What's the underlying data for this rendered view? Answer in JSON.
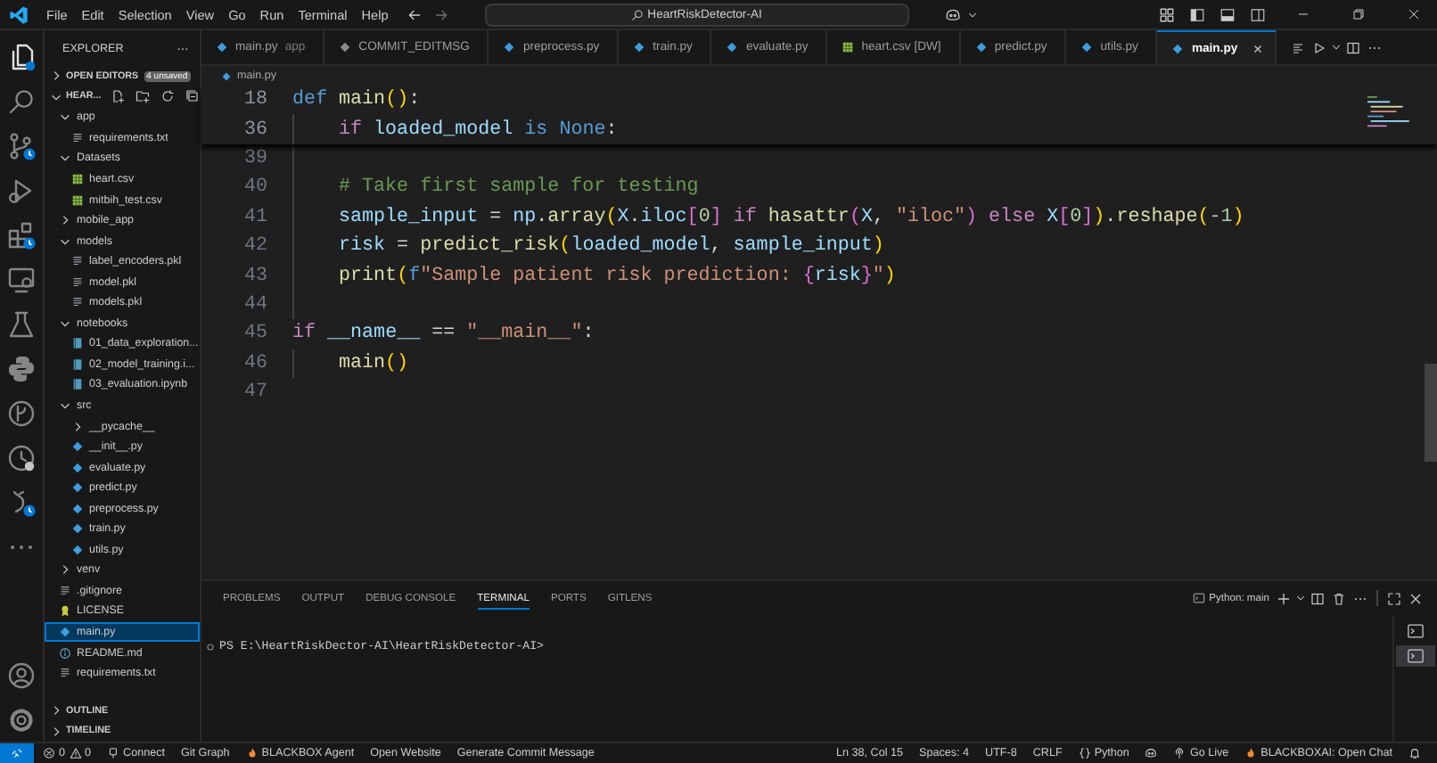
{
  "title_bar": {
    "menu": [
      "File",
      "Edit",
      "Selection",
      "View",
      "Go",
      "Run",
      "Terminal",
      "Help"
    ],
    "search": {
      "value": "HeartRiskDetector-AI"
    }
  },
  "activity_bar": [
    {
      "kind": "explorer",
      "selected": true
    },
    {
      "kind": "search",
      "selected": false
    },
    {
      "kind": "source-control",
      "selected": false
    },
    {
      "kind": "run",
      "selected": false
    },
    {
      "kind": "extensions",
      "selected": false
    },
    {
      "kind": "remote",
      "selected": false
    },
    {
      "kind": "testing",
      "selected": false
    },
    {
      "kind": "python",
      "selected": false
    },
    {
      "kind": "git-graph",
      "selected": false
    },
    {
      "kind": "history",
      "selected": false
    },
    {
      "kind": "agent",
      "selected": false
    },
    {
      "kind": "more",
      "selected": false
    }
  ],
  "explorer": {
    "title": "EXPLORER",
    "open_editors": {
      "label": "OPEN EDITORS",
      "badge": "4 unsaved",
      "expanded": false
    },
    "folder": {
      "label": "HEAR...",
      "expanded": true
    },
    "tree": [
      {
        "label": "app",
        "kind": "folder",
        "expanded": true,
        "selected": false,
        "children": [
          {
            "label": "requirements.txt",
            "kind": "text",
            "selected": false
          }
        ]
      },
      {
        "label": "Datasets",
        "kind": "folder",
        "expanded": true,
        "selected": false,
        "children": [
          {
            "label": "heart.csv",
            "kind": "table",
            "selected": false
          },
          {
            "label": "mitbih_test.csv",
            "kind": "table",
            "selected": false
          }
        ]
      },
      {
        "label": "mobile_app",
        "kind": "folder",
        "expanded": false,
        "selected": false
      },
      {
        "label": "models",
        "kind": "folder",
        "expanded": true,
        "selected": false,
        "children": [
          {
            "label": "label_encoders.pkl",
            "kind": "text",
            "selected": false
          },
          {
            "label": "model.pkl",
            "kind": "text",
            "selected": false
          },
          {
            "label": "models.pkl",
            "kind": "text",
            "selected": false
          }
        ]
      },
      {
        "label": "notebooks",
        "kind": "folder",
        "expanded": true,
        "selected": false,
        "children": [
          {
            "label": "01_data_exploration...",
            "kind": "notebook",
            "selected": false
          },
          {
            "label": "02_model_training.i...",
            "kind": "notebook",
            "selected": false
          },
          {
            "label": "03_evaluation.ipynb",
            "kind": "notebook",
            "selected": false
          }
        ]
      },
      {
        "label": "src",
        "kind": "folder",
        "expanded": true,
        "selected": false,
        "children": [
          {
            "label": "__pycache__",
            "kind": "folder",
            "expanded": false,
            "selected": false
          },
          {
            "label": "__init__.py",
            "kind": "python",
            "selected": false
          },
          {
            "label": "evaluate.py",
            "kind": "python",
            "selected": false
          },
          {
            "label": "predict.py",
            "kind": "python",
            "selected": false
          },
          {
            "label": "preprocess.py",
            "kind": "python",
            "selected": false
          },
          {
            "label": "train.py",
            "kind": "python",
            "selected": false
          },
          {
            "label": "utils.py",
            "kind": "python",
            "selected": false
          }
        ]
      },
      {
        "label": "venv",
        "kind": "folder",
        "expanded": false,
        "selected": false
      },
      {
        "label": ".gitignore",
        "kind": "text",
        "selected": false
      },
      {
        "label": "LICENSE",
        "kind": "license",
        "selected": false
      },
      {
        "label": "main.py",
        "kind": "python",
        "selected": true
      },
      {
        "label": "README.md",
        "kind": "info",
        "selected": false
      },
      {
        "label": "requirements.txt",
        "kind": "text",
        "selected": false
      }
    ],
    "sections": [
      {
        "label": "OUTLINE",
        "expanded": false
      },
      {
        "label": "TIMELINE",
        "expanded": false
      }
    ]
  },
  "tabs": [
    {
      "label": "main.py",
      "detail": "app",
      "kind": "python",
      "selected": false
    },
    {
      "label": "COMMIT_EDITMSG",
      "kind": "git",
      "selected": false
    },
    {
      "label": "preprocess.py",
      "kind": "python",
      "selected": false
    },
    {
      "label": "train.py",
      "kind": "python",
      "selected": false
    },
    {
      "label": "evaluate.py",
      "kind": "python",
      "selected": false
    },
    {
      "label": "heart.csv [DW]",
      "kind": "table",
      "selected": false
    },
    {
      "label": "predict.py",
      "kind": "python",
      "selected": false
    },
    {
      "label": "utils.py",
      "kind": "python",
      "selected": false
    },
    {
      "label": "main.py",
      "kind": "python",
      "selected": true
    }
  ],
  "breadcrumb": [
    "main.py"
  ],
  "editor": {
    "sticky_lines": [
      {
        "number": "18",
        "indented": false,
        "tokens": [
          {
            "t": "def ",
            "kind": "kw"
          },
          {
            "t": "main",
            "kind": "fn"
          },
          {
            "t": "()",
            "kind": "b1"
          },
          {
            "t": ":",
            "kind": "plain"
          }
        ]
      },
      {
        "number": "36",
        "indented": true,
        "tokens": [
          {
            "t": "if ",
            "kind": "ctrl"
          },
          {
            "t": "loaded_model ",
            "kind": "var"
          },
          {
            "t": "is ",
            "kind": "kw"
          },
          {
            "t": "None",
            "kind": "kw"
          },
          {
            "t": ":",
            "kind": "plain"
          }
        ]
      }
    ],
    "lines": [
      {
        "number": "39",
        "indented": true
      },
      {
        "number": "40",
        "indented": true,
        "tokens": [
          {
            "t": "# Take first sample for testing",
            "kind": "cmt"
          }
        ]
      },
      {
        "number": "41",
        "indented": true,
        "tokens": [
          {
            "t": "sample_input",
            "kind": "var"
          },
          {
            "t": " = ",
            "kind": "plain"
          },
          {
            "t": "np",
            "kind": "var"
          },
          {
            "t": ".",
            "kind": "plain"
          },
          {
            "t": "array",
            "kind": "fn"
          },
          {
            "t": "(",
            "kind": "b1"
          },
          {
            "t": "X",
            "kind": "var"
          },
          {
            "t": ".",
            "kind": "plain"
          },
          {
            "t": "iloc",
            "kind": "var"
          },
          {
            "t": "[",
            "kind": "b2"
          },
          {
            "t": "0",
            "kind": "num"
          },
          {
            "t": "] ",
            "kind": "b2"
          },
          {
            "t": "if ",
            "kind": "ctrl"
          },
          {
            "t": "hasattr",
            "kind": "fn"
          },
          {
            "t": "(",
            "kind": "b2"
          },
          {
            "t": "X",
            "kind": "var"
          },
          {
            "t": ", ",
            "kind": "plain"
          },
          {
            "t": "\"iloc\"",
            "kind": "str"
          },
          {
            "t": ") ",
            "kind": "b2"
          },
          {
            "t": "else ",
            "kind": "ctrl"
          },
          {
            "t": "X",
            "kind": "var"
          },
          {
            "t": "[",
            "kind": "b2"
          },
          {
            "t": "0",
            "kind": "num"
          },
          {
            "t": "]",
            "kind": "b2"
          },
          {
            "t": ")",
            "kind": "b1"
          },
          {
            "t": ".",
            "kind": "plain"
          },
          {
            "t": "reshape",
            "kind": "fn"
          },
          {
            "t": "(",
            "kind": "b1"
          },
          {
            "t": "-1",
            "kind": "num"
          },
          {
            "t": ")",
            "kind": "b1"
          }
        ]
      },
      {
        "number": "42",
        "indented": true,
        "tokens": [
          {
            "t": "risk",
            "kind": "var"
          },
          {
            "t": " = ",
            "kind": "plain"
          },
          {
            "t": "predict_risk",
            "kind": "fn"
          },
          {
            "t": "(",
            "kind": "b1"
          },
          {
            "t": "loaded_model",
            "kind": "var"
          },
          {
            "t": ", ",
            "kind": "plain"
          },
          {
            "t": "sample_input",
            "kind": "var"
          },
          {
            "t": ")",
            "kind": "b1"
          }
        ]
      },
      {
        "number": "43",
        "indented": true,
        "tokens": [
          {
            "t": "print",
            "kind": "fn"
          },
          {
            "t": "(",
            "kind": "b1"
          },
          {
            "t": "f",
            "kind": "kw"
          },
          {
            "t": "\"Sample patient risk prediction: ",
            "kind": "str"
          },
          {
            "t": "{",
            "kind": "b2"
          },
          {
            "t": "risk",
            "kind": "var"
          },
          {
            "t": "}",
            "kind": "b2"
          },
          {
            "t": "\"",
            "kind": "str"
          },
          {
            "t": ")",
            "kind": "b1"
          }
        ]
      },
      {
        "number": "44",
        "indented": true
      },
      {
        "number": "45",
        "indented": false,
        "tokens": [
          {
            "t": "if ",
            "kind": "ctrl"
          },
          {
            "t": "__name__",
            "kind": "var"
          },
          {
            "t": " == ",
            "kind": "plain"
          },
          {
            "t": "\"__main__\"",
            "kind": "str"
          },
          {
            "t": ":",
            "kind": "plain"
          }
        ]
      },
      {
        "number": "46",
        "indented": true,
        "tokens": [
          {
            "t": "main",
            "kind": "fn"
          },
          {
            "t": "()",
            "kind": "b1"
          }
        ]
      },
      {
        "number": "47",
        "indented": false
      }
    ]
  },
  "panel": {
    "tabs": [
      {
        "label": "PROBLEMS",
        "selected": false
      },
      {
        "label": "OUTPUT",
        "selected": false
      },
      {
        "label": "DEBUG CONSOLE",
        "selected": false
      },
      {
        "label": "TERMINAL",
        "selected": true
      },
      {
        "label": "PORTS",
        "selected": false
      },
      {
        "label": "GITLENS",
        "selected": false
      }
    ],
    "terminal_name": "Python: main",
    "prompt": "PS E:\\HeartRiskDector-AI\\HeartRiskDetector-AI>",
    "terminals": [
      {
        "selected": false
      },
      {
        "selected": true
      }
    ]
  },
  "status_bar": {
    "left": [
      {
        "kind": "remote"
      },
      {
        "kind": "problems",
        "errors": "0",
        "warnings": "0"
      },
      {
        "kind": "plug",
        "label": "Connect"
      },
      {
        "kind": "plain",
        "label": "Git Graph"
      },
      {
        "kind": "flame",
        "label": "BLACKBOX Agent"
      },
      {
        "kind": "plain",
        "label": "Open Website"
      },
      {
        "kind": "plain",
        "label": "Generate Commit Message"
      }
    ],
    "right": [
      {
        "kind": "plain",
        "label": "Ln 38, Col 15"
      },
      {
        "kind": "plain",
        "label": "Spaces: 4"
      },
      {
        "kind": "plain",
        "label": "UTF-8"
      },
      {
        "kind": "plain",
        "label": "CRLF"
      },
      {
        "kind": "braces",
        "label": "Python"
      },
      {
        "kind": "copilot"
      },
      {
        "kind": "broadcast",
        "label": "Go Live"
      },
      {
        "kind": "flame",
        "label": "BLACKBOXAI: Open Chat"
      },
      {
        "kind": "bell"
      }
    ]
  }
}
